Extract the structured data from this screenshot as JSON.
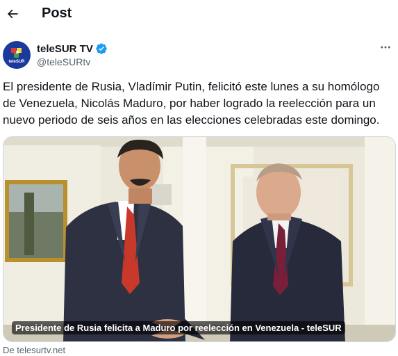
{
  "header": {
    "title": "Post",
    "back_icon": "arrow-left-icon"
  },
  "author": {
    "display_name": "teleSUR TV",
    "handle": "@teleSURtv",
    "verified": true,
    "avatar_text": "teleSUR",
    "verified_color": "#1d9bf0"
  },
  "tweet": {
    "text": "El presidente de Rusia, Vladímir Putin, felicitó este lunes a su  homólogo\nde Venezuela, Nicolás Maduro, por haber logrado la reelección  para un\nnuevo periodo de seis años en las elecciones celebradas este  domingo."
  },
  "card": {
    "caption": "Presidente de Rusia felicita a Maduro por reelección en Venezuela - teleSUR",
    "source": "De telesurtv.net"
  },
  "icons": {
    "more": "more-horizontal-icon"
  }
}
